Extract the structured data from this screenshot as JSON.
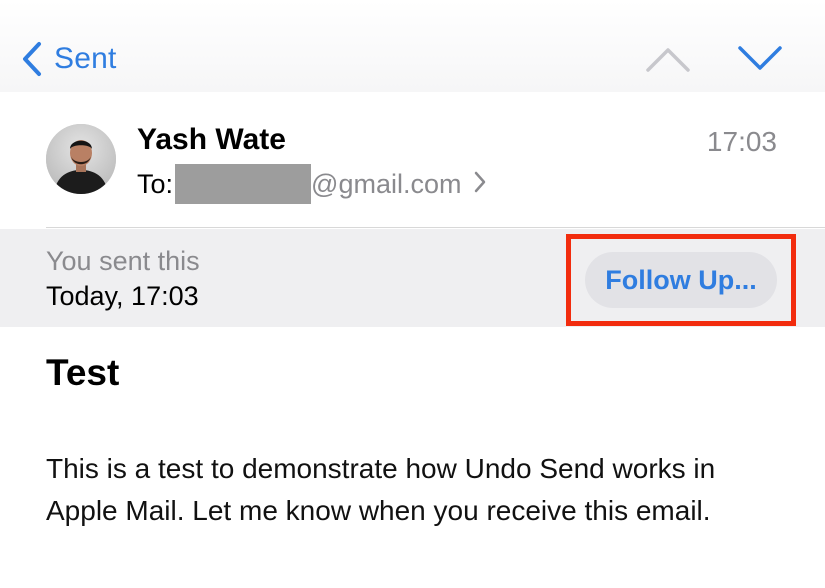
{
  "nav": {
    "back_label": "Sent",
    "back_icon": "chevron-left-icon",
    "prev_icon": "chevron-up-icon",
    "next_icon": "chevron-down-icon"
  },
  "message": {
    "sender_name": "Yash Wate",
    "to_label": "To:",
    "recipient_email_suffix": "@gmail.com",
    "time": "17:03",
    "sent_caption": "You sent this",
    "sent_date": "Today, 17:03",
    "follow_up_label": "Follow Up...",
    "subject": "Test",
    "body": "This is a test to demonstrate how Undo Send works in Apple Mail. Let me know when you receive this email."
  },
  "colors": {
    "accent": "#2f7de0",
    "secondary_text": "#8a8a8e",
    "highlight": "#f22c0e",
    "banner_background": "#efeff1"
  }
}
